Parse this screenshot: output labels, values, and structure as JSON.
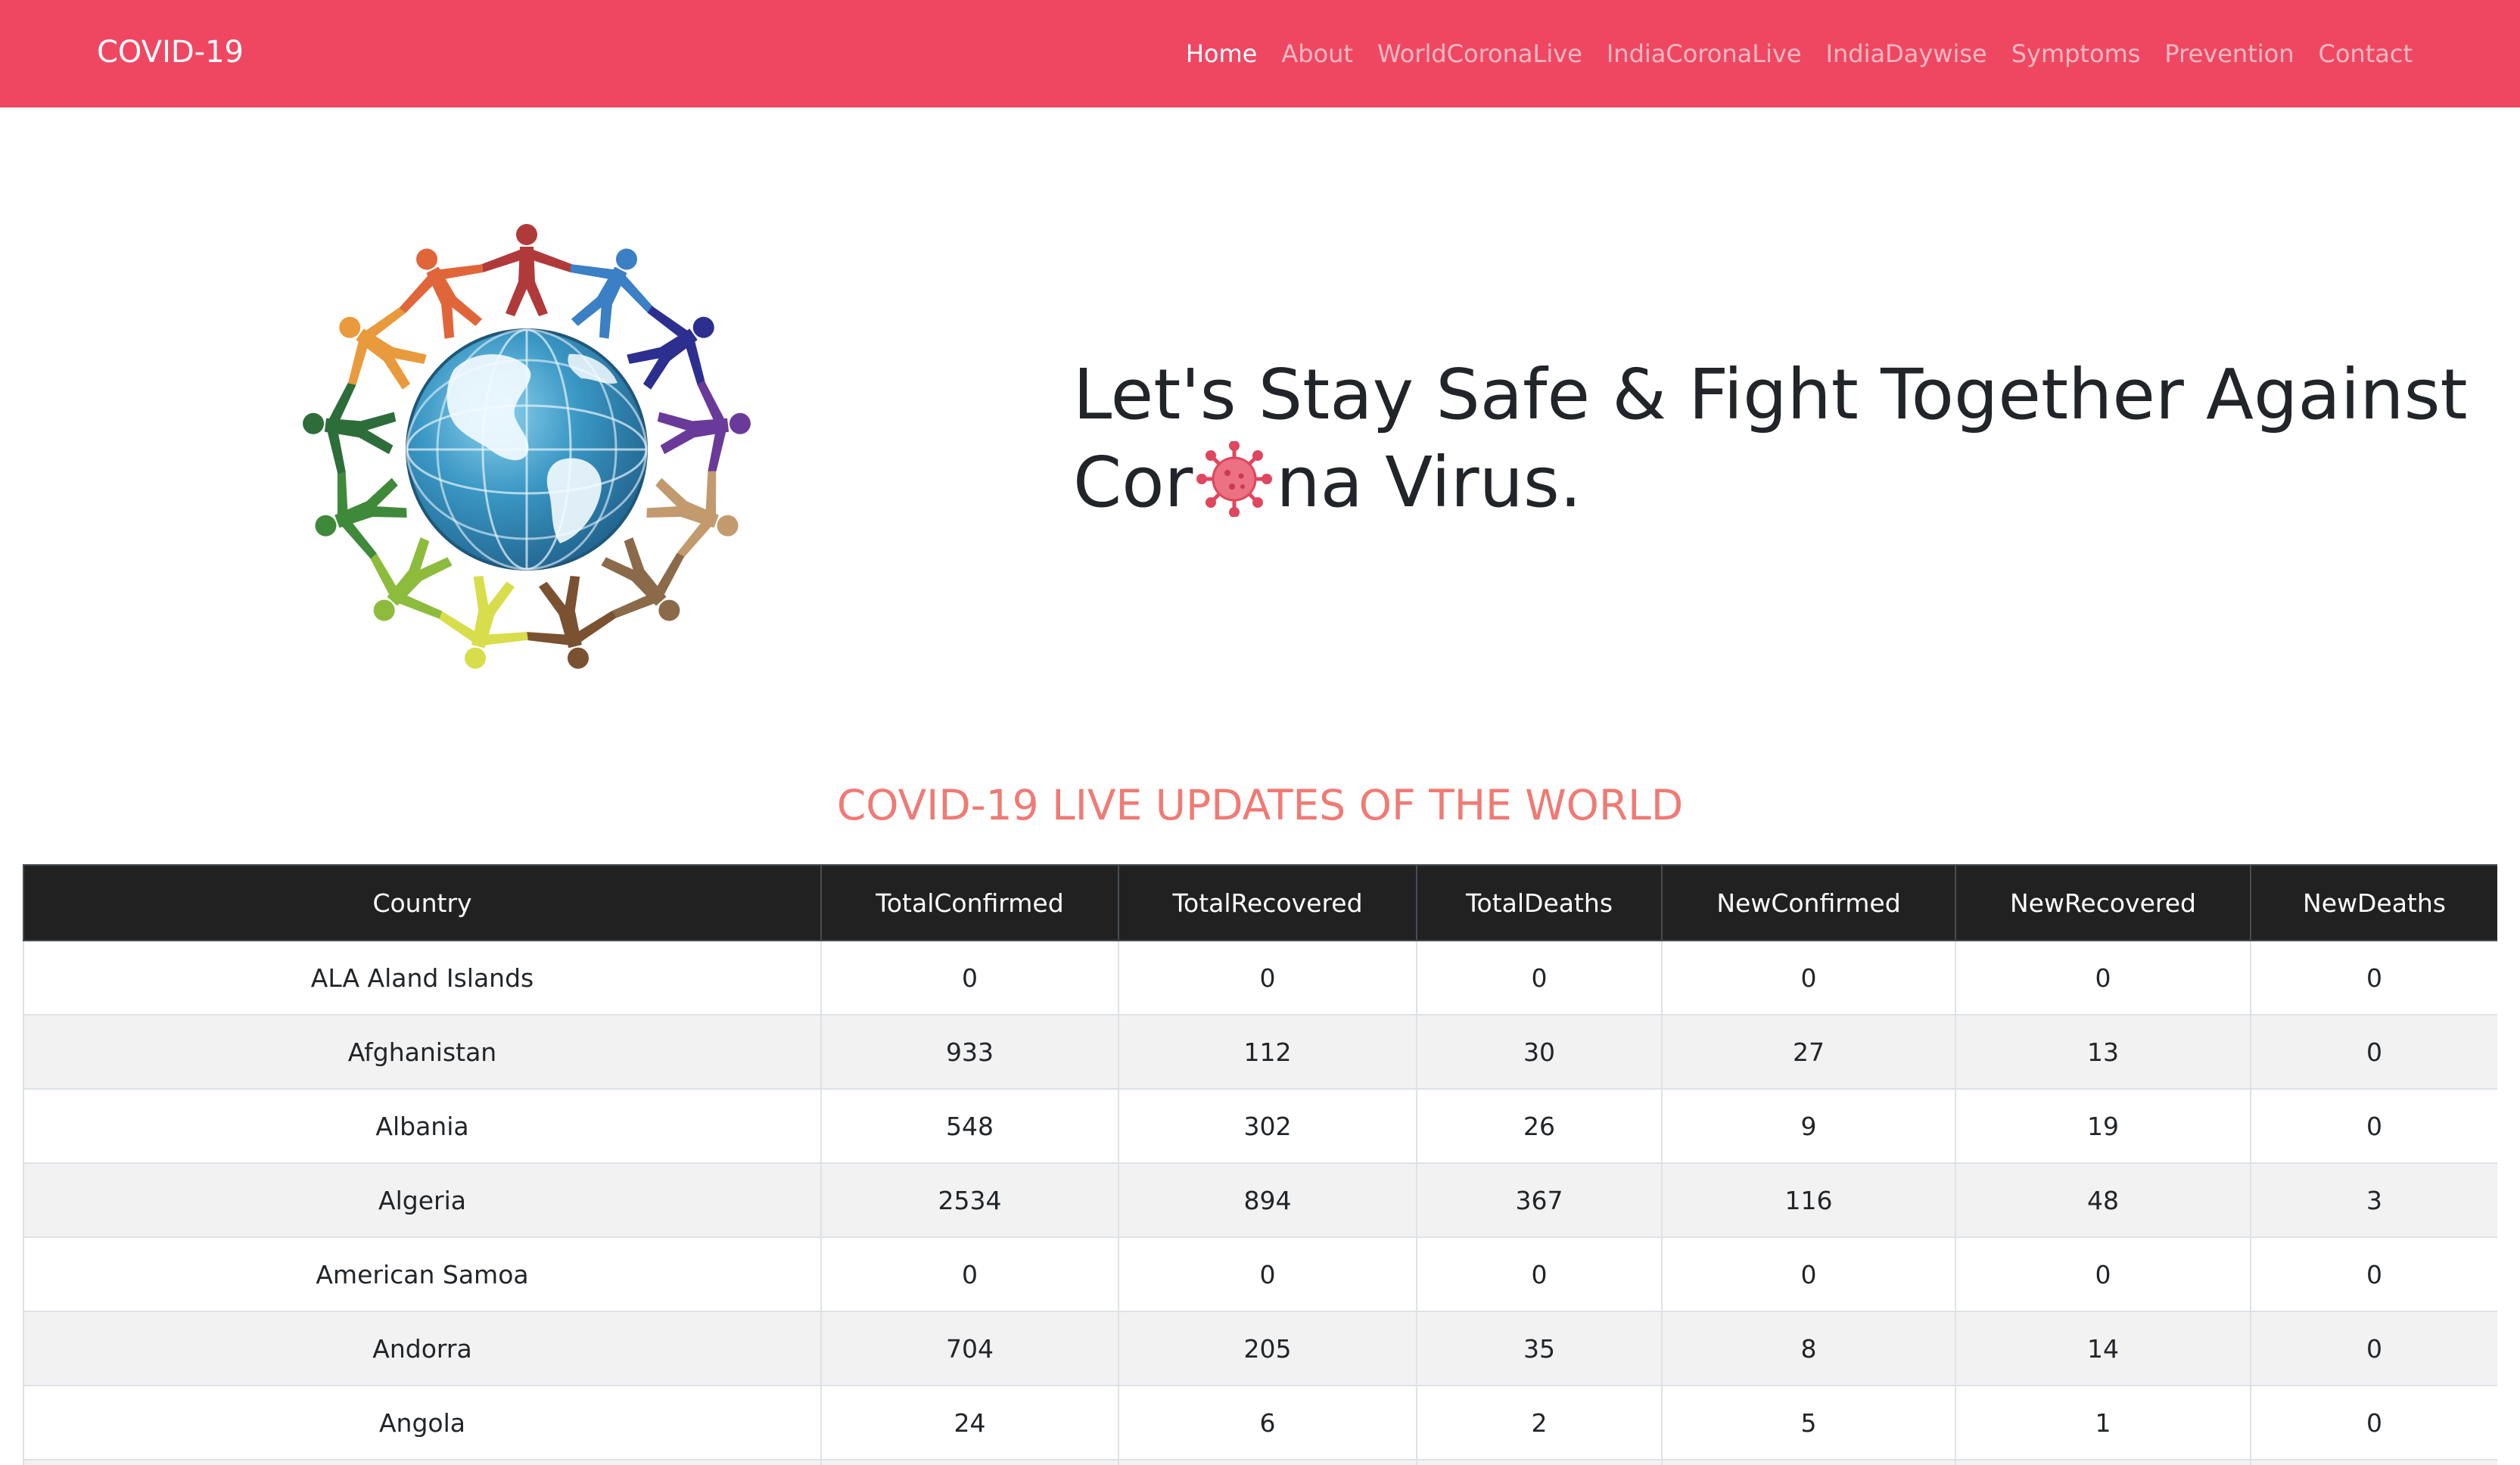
{
  "navbar": {
    "brand": "COVID-19",
    "links": [
      {
        "label": "Home",
        "active": true
      },
      {
        "label": "About"
      },
      {
        "label": "WorldCoronaLive"
      },
      {
        "label": "IndiaCoronaLive"
      },
      {
        "label": "IndiaDaywise"
      },
      {
        "label": "Symptoms"
      },
      {
        "label": "Prevention"
      },
      {
        "label": "Contact"
      }
    ]
  },
  "hero": {
    "title_line1": "Let's Stay Safe & Fight Together Against",
    "title_line2_prefix": "Cor",
    "title_line2_suffix": "na Virus."
  },
  "section": {
    "title": "COVID-19 LIVE UPDATES OF THE WORLD"
  },
  "table": {
    "headers": [
      "Country",
      "TotalConfirmed",
      "TotalRecovered",
      "TotalDeaths",
      "NewConfirmed",
      "NewRecovered",
      "NewDeaths"
    ],
    "rows": [
      [
        "ALA Aland Islands",
        "0",
        "0",
        "0",
        "0",
        "0",
        "0"
      ],
      [
        "Afghanistan",
        "933",
        "112",
        "30",
        "27",
        "13",
        "0"
      ],
      [
        "Albania",
        "548",
        "302",
        "26",
        "9",
        "19",
        "0"
      ],
      [
        "Algeria",
        "2534",
        "894",
        "367",
        "116",
        "48",
        "3"
      ],
      [
        "American Samoa",
        "0",
        "0",
        "0",
        "0",
        "0",
        "0"
      ],
      [
        "Andorra",
        "704",
        "205",
        "35",
        "8",
        "14",
        "0"
      ],
      [
        "Angola",
        "24",
        "6",
        "2",
        "5",
        "1",
        "0"
      ]
    ]
  },
  "colors": {
    "navbar": "#ef4762",
    "section_title": "#f07a74",
    "table_header": "#212121"
  }
}
